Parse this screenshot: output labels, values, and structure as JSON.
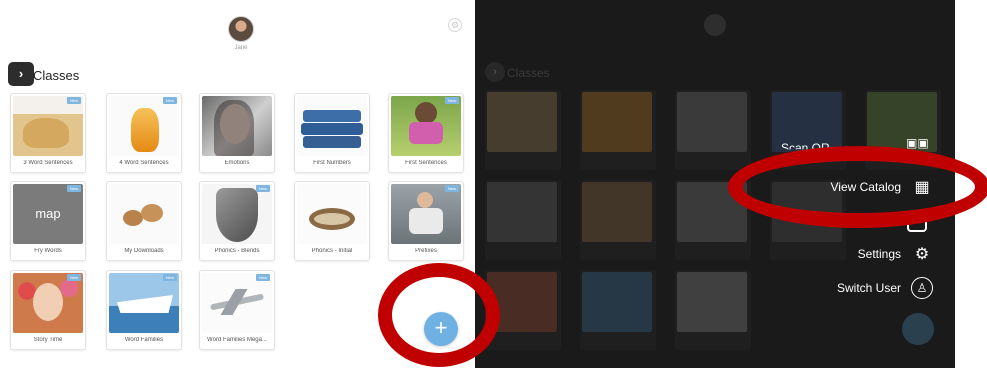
{
  "left": {
    "user_name": "Jane",
    "section_title": "Classes",
    "toggle_glyph": "›",
    "tiles": [
      {
        "label": "3 Word Sentences",
        "badge": "New",
        "icon": "lion-cub-image"
      },
      {
        "label": "4 Word Sentences",
        "badge": "New",
        "icon": "honey-jar-image"
      },
      {
        "label": "Emotions",
        "badge": "",
        "icon": "woman-portrait-image"
      },
      {
        "label": "First Numbers",
        "badge": "",
        "icon": "jeans-stack-image"
      },
      {
        "label": "First Sentences",
        "badge": "New",
        "icon": "girl-bicycle-image"
      },
      {
        "label": "Fry Words",
        "badge": "New",
        "icon": "map-text-image",
        "image_text": "map"
      },
      {
        "label": "My Downloads",
        "badge": "",
        "icon": "bread-rolls-image"
      },
      {
        "label": "Phonics - Blends",
        "badge": "New",
        "icon": "shield-image"
      },
      {
        "label": "Phonics - Initial",
        "badge": "",
        "icon": "bird-nest-image"
      },
      {
        "label": "Prefixes",
        "badge": "New",
        "icon": "sitting-boy-image"
      },
      {
        "label": "Story Time",
        "badge": "New",
        "icon": "girl-flowers-image"
      },
      {
        "label": "Word Families",
        "badge": "New",
        "icon": "cruise-ship-image"
      },
      {
        "label": "Word Families Mega...",
        "badge": "New",
        "icon": "airplane-image"
      }
    ],
    "fab_glyph": "+"
  },
  "right": {
    "section_title": "Classes",
    "partial_menu_label": "Scan QR",
    "menu": [
      {
        "label": "View Catalog",
        "icon": "grid-icon",
        "glyph": "▦"
      },
      {
        "label": "Settings",
        "icon": "gear-icon",
        "glyph": "⚙"
      },
      {
        "label": "Switch User",
        "icon": "user-circle-icon",
        "glyph": "♙"
      }
    ]
  },
  "colors": {
    "highlight_ring": "#c00000",
    "fab": "#6fb1e2",
    "badge": "#7fb6e0",
    "overlay": "#1a1a1a"
  }
}
